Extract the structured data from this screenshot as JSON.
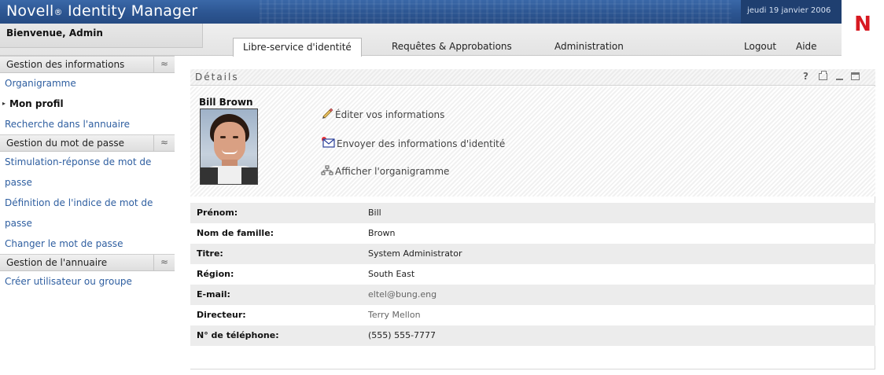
{
  "header": {
    "app_name": "Novell",
    "app_registered": "®",
    "app_product": " Identity Manager",
    "date": "jeudi 19 janvier 2006",
    "logo_letter": "N",
    "brand_color": "#d71921"
  },
  "nav": {
    "welcome": "Bienvenue, Admin",
    "tabs": [
      {
        "label": "Libre-service d'identité",
        "active": true
      },
      {
        "label": "Requêtes & Approbations",
        "active": false
      },
      {
        "label": "Administration",
        "active": false
      }
    ],
    "logout": "Logout",
    "help": "Aide"
  },
  "sidebar": {
    "sections": [
      {
        "title": "Gestion des informations",
        "items": [
          "Organigramme",
          "Mon profil",
          "Recherche dans l'annuaire"
        ]
      },
      {
        "title": "Gestion du mot de passe",
        "items": [
          "Stimulation-réponse de mot de passe",
          "Définition de l'indice de mot de passe",
          "Changer le mot de passe"
        ]
      },
      {
        "title": "Gestion de l'annuaire",
        "items": [
          "Créer utilisateur ou groupe"
        ]
      }
    ],
    "collapse_glyph": "≈"
  },
  "portlet": {
    "title": "Détails",
    "help_glyph": "?",
    "person_name": "Bill Brown",
    "actions": {
      "edit": "Éditer vos informations",
      "send": "Envoyer des informations d'identité",
      "org": "Afficher l'organigramme"
    },
    "fields": [
      {
        "label": "Prénom:",
        "value": "Bill"
      },
      {
        "label": "Nom de famille:",
        "value": "Brown"
      },
      {
        "label": "Titre:",
        "value": "System Administrator"
      },
      {
        "label": "Région:",
        "value": "South East"
      },
      {
        "label": "E-mail:",
        "value": "eltel@bung.eng"
      },
      {
        "label": "Directeur:",
        "value": "Terry Mellon"
      },
      {
        "label": "N° de téléphone:",
        "value": "(555) 555-7777"
      }
    ]
  }
}
